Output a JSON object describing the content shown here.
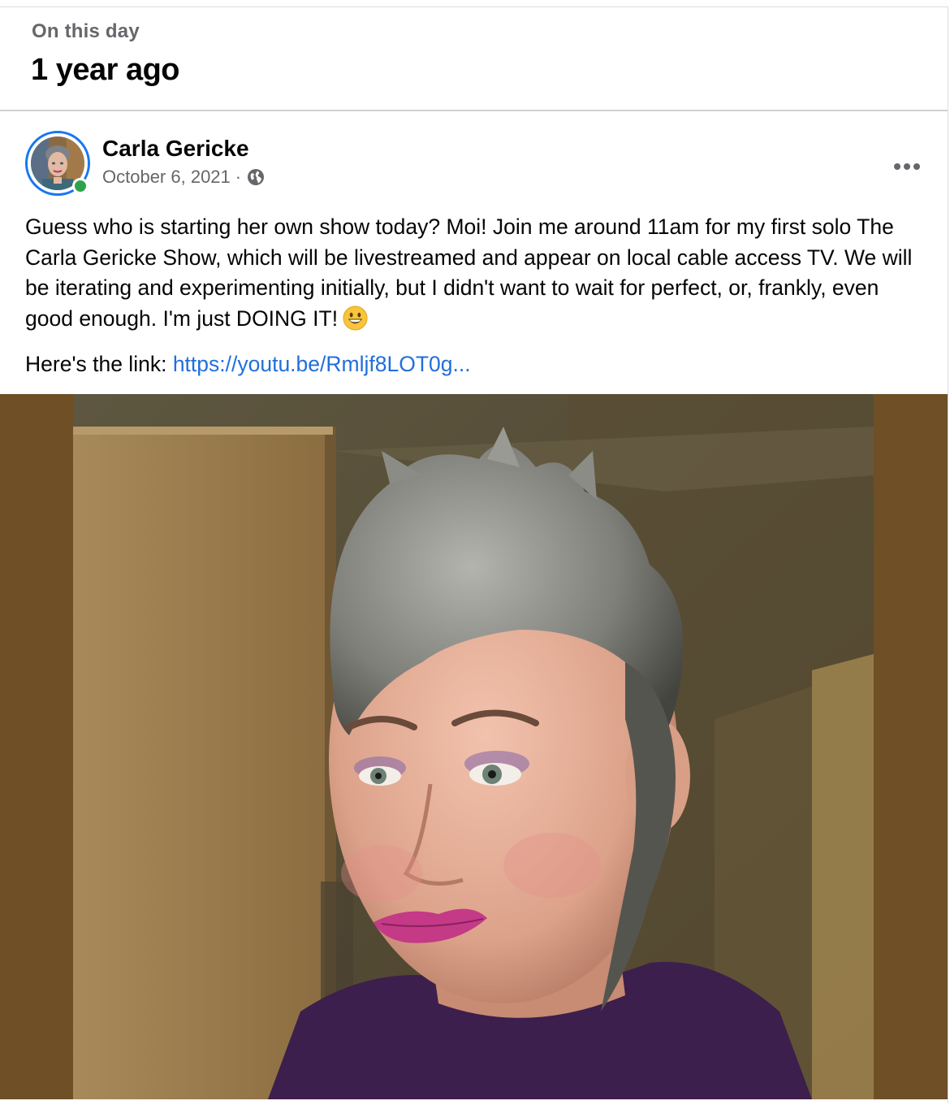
{
  "memory": {
    "kicker": "On this day",
    "title": "1 year ago"
  },
  "post": {
    "author": "Carla Gericke",
    "date": "October 6, 2021",
    "separator": "·",
    "audience_icon": "globe-icon",
    "more_icon": "more-options-icon",
    "online": true,
    "text": "Guess who is starting her own show today? Moi! Join me around 11am for my first solo The Carla Gericke Show, which will be livestreamed and appear on local cable access TV. We will be iterating and experimenting initially, but I didn't want to wait for perfect, or, frankly, even good enough. I'm just DOING IT!",
    "emoji": "grinning-face-emoji",
    "link_prefix": "Here's the link:",
    "link_text": "https://youtu.be/Rmljf8LOT0g..."
  },
  "colors": {
    "link": "#216fdb",
    "online": "#31a24c",
    "avatar_ring": "#1877f2",
    "photo_background": "#6e4f26"
  }
}
